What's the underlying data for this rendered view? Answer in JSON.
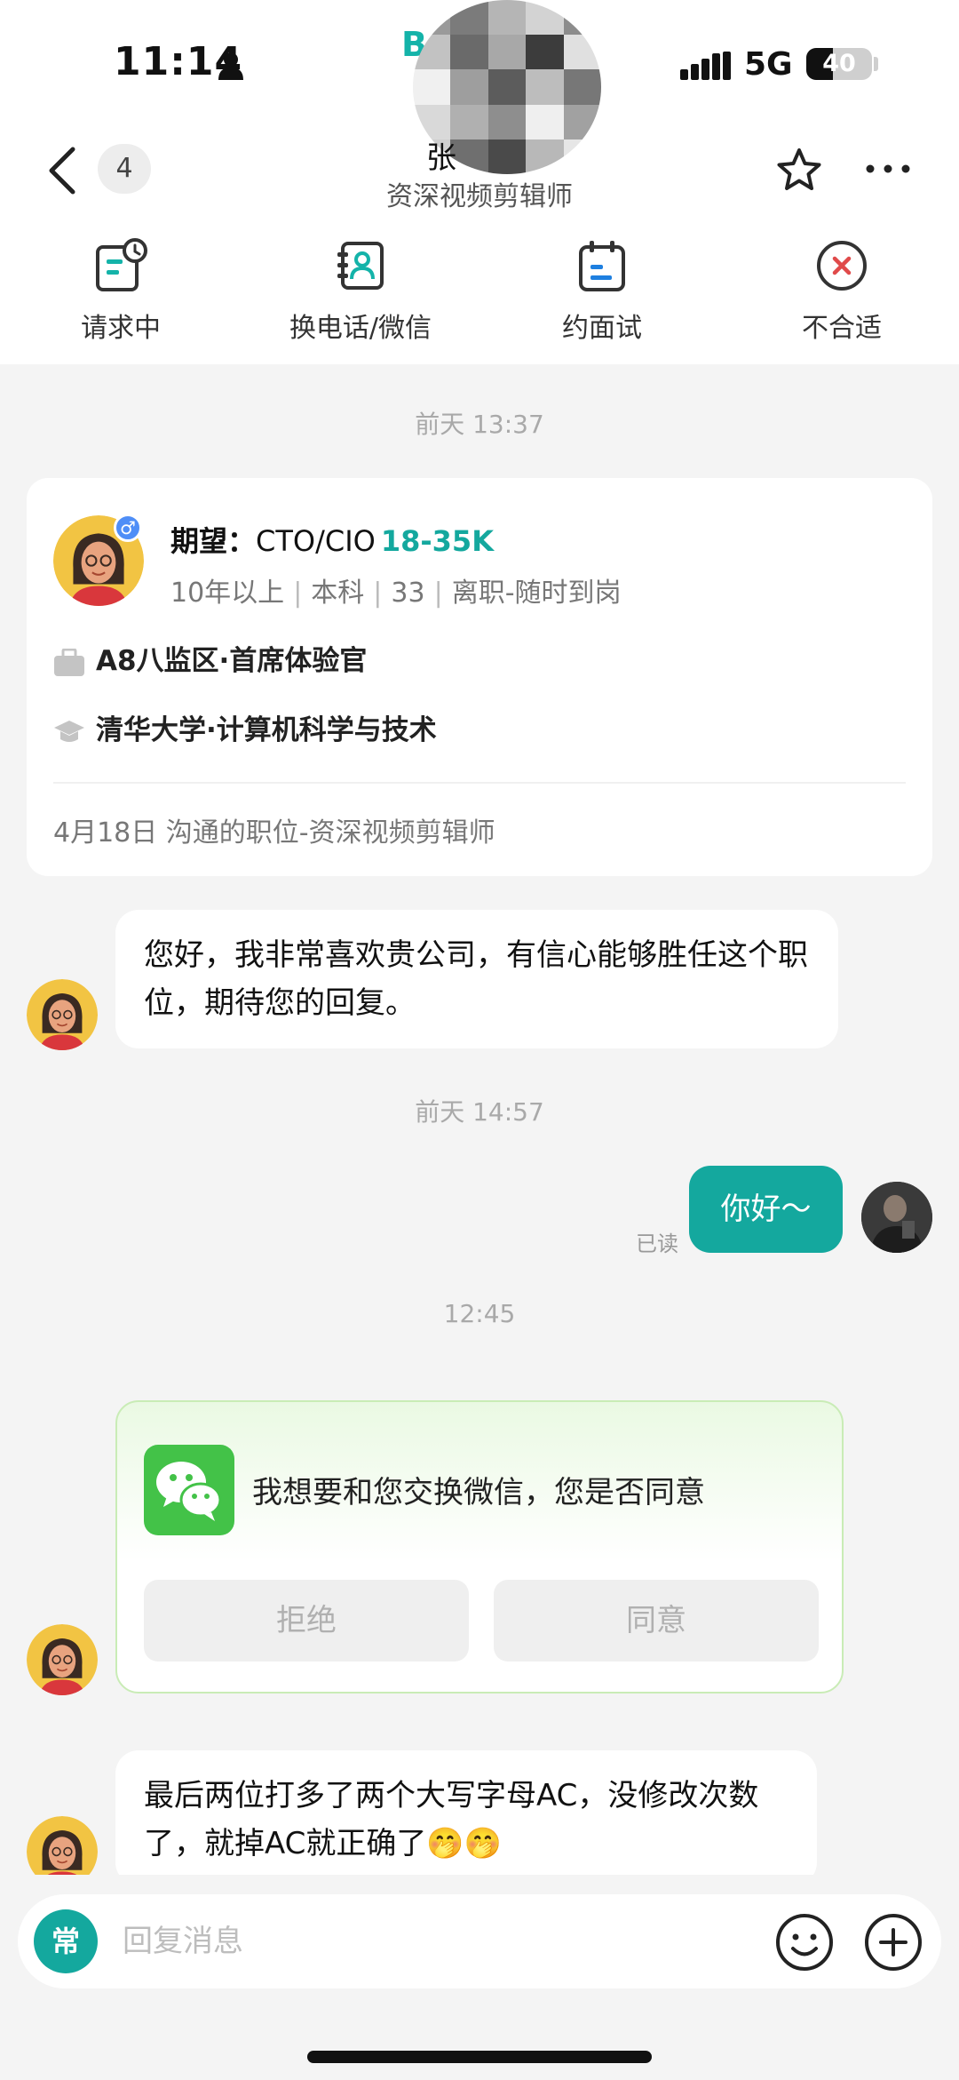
{
  "status_bar": {
    "time": "11:14",
    "network": "5G",
    "battery_text": "40",
    "battery_level": 0.4
  },
  "header": {
    "unread_count": "4",
    "brand_fragment": "B",
    "name_fragment": "张",
    "subtitle": "资深视频剪辑师"
  },
  "actions": [
    {
      "label": "请求中",
      "icon": "request-pending-icon"
    },
    {
      "label": "换电话/微信",
      "icon": "exchange-contact-icon"
    },
    {
      "label": "约面试",
      "icon": "calendar-icon"
    },
    {
      "label": "不合适",
      "icon": "reject-circle-icon"
    }
  ],
  "chat": {
    "timestamps": [
      "前天 13:37",
      "前天 14:57",
      "12:45"
    ],
    "resume_card": {
      "expect_label": "期望：",
      "expect_role": "CTO/CIO",
      "salary": "18-35K",
      "meta": [
        "10年以上",
        "本科",
        "33",
        "离职-随时到岗"
      ],
      "work": "A8八监区·首席体验官",
      "education": "清华大学·计算机科学与技术",
      "footer": "4月18日 沟通的职位-资深视频剪辑师",
      "gender_symbol": "♂"
    },
    "msg1": "您好，我非常喜欢贵公司，有信心能够胜任这个职位，期待您的回复。",
    "my_msg": "你好～",
    "read_label": "已读",
    "wechat_request": {
      "text": "我想要和您交换微信，您是否同意",
      "reject_label": "拒绝",
      "accept_label": "同意"
    },
    "msg2": "最后两位打多了两个大写字母AC，没修改次数了，就掉AC就正确了🤭🤭"
  },
  "input_bar": {
    "common_label": "常",
    "placeholder": "回复消息"
  },
  "colors": {
    "accent": "#14a89e",
    "wechat_green": "#43c248"
  }
}
